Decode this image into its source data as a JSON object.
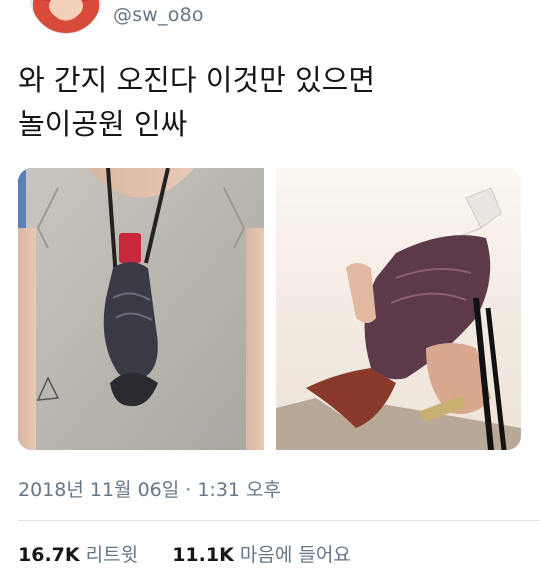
{
  "author": {
    "handle": "@sw_o8o"
  },
  "tweet": {
    "text": "와 간지 오진다 이것만 있으면\n놀이공원 인싸"
  },
  "media": {
    "photos": [
      "fish-shaped drink bottle on lanyard worn on t-shirt",
      "hand holding fish-shaped bottle"
    ]
  },
  "meta": {
    "timestamp": "2018년 11월 06일 · 1:31 오후"
  },
  "stats": {
    "retweets_count": "16.7K",
    "retweets_label": "리트윗",
    "likes_count": "11.1K",
    "likes_label": "마음에 들어요"
  },
  "colors": {
    "text": "#14171a",
    "secondary": "#657786",
    "divider": "#e1e8ed"
  }
}
